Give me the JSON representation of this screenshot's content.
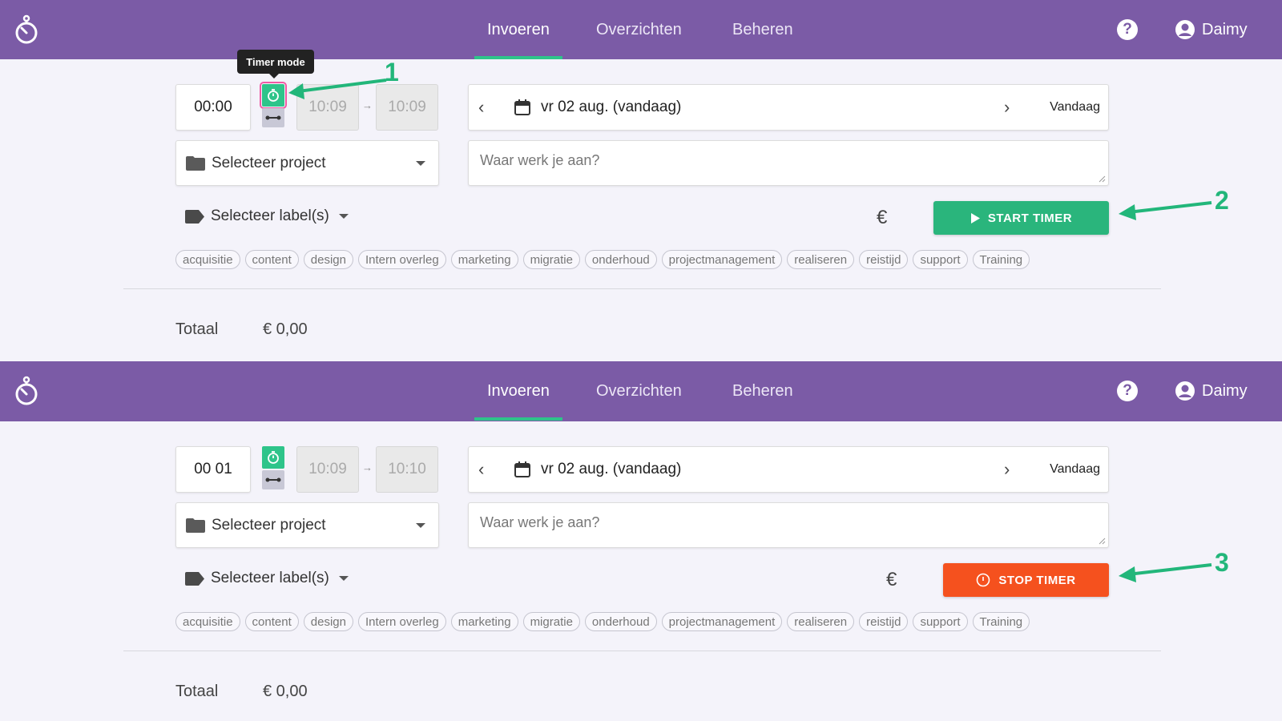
{
  "colors": {
    "navbar": "#7b5ba6",
    "accent_green": "#2ec48a",
    "start_button": "#2ab57c",
    "stop_button": "#f5511e",
    "annotation": "#22b67a",
    "highlight": "#f05aa5"
  },
  "nav": {
    "tabs": [
      "Invoeren",
      "Overzichten",
      "Beheren"
    ],
    "active_tab": "Invoeren",
    "user_name": "Daimy",
    "help_label": "?"
  },
  "tooltip": "Timer mode",
  "top": {
    "duration": "00:00",
    "start_time": "10:09",
    "end_time": "10:09",
    "date": "vr 02 aug. (vandaag)",
    "today_label": "Vandaag",
    "project_placeholder": "Selecteer project",
    "description_placeholder": "Waar werk je aan?",
    "label_placeholder": "Selecteer label(s)",
    "currency": "€",
    "button_label": "START TIMER",
    "total_label": "Totaal",
    "total_value": "€ 0,00"
  },
  "bottom": {
    "duration": "00 01",
    "start_time": "10:09",
    "end_time": "10:10",
    "date": "vr 02 aug. (vandaag)",
    "today_label": "Vandaag",
    "project_placeholder": "Selecteer project",
    "description_placeholder": "Waar werk je aan?",
    "label_placeholder": "Selecteer label(s)",
    "currency": "€",
    "button_label": "STOP TIMER",
    "total_label": "Totaal",
    "total_value": "€ 0,00"
  },
  "tags": [
    "acquisitie",
    "content",
    "design",
    "Intern overleg",
    "marketing",
    "migratie",
    "onderhoud",
    "projectmanagement",
    "realiseren",
    "reistijd",
    "support",
    "Training"
  ],
  "annotations": [
    "1",
    "2",
    "3"
  ],
  "icons": {
    "logo": "stopwatch-logo-icon",
    "help": "help-icon",
    "user": "user-circle-icon",
    "calendar": "calendar-icon",
    "folder": "folder-icon",
    "tag": "tag-icon",
    "timer_mode": "stopwatch-icon",
    "range_mode": "range-icon",
    "play": "play-icon",
    "stop": "stop-icon"
  }
}
